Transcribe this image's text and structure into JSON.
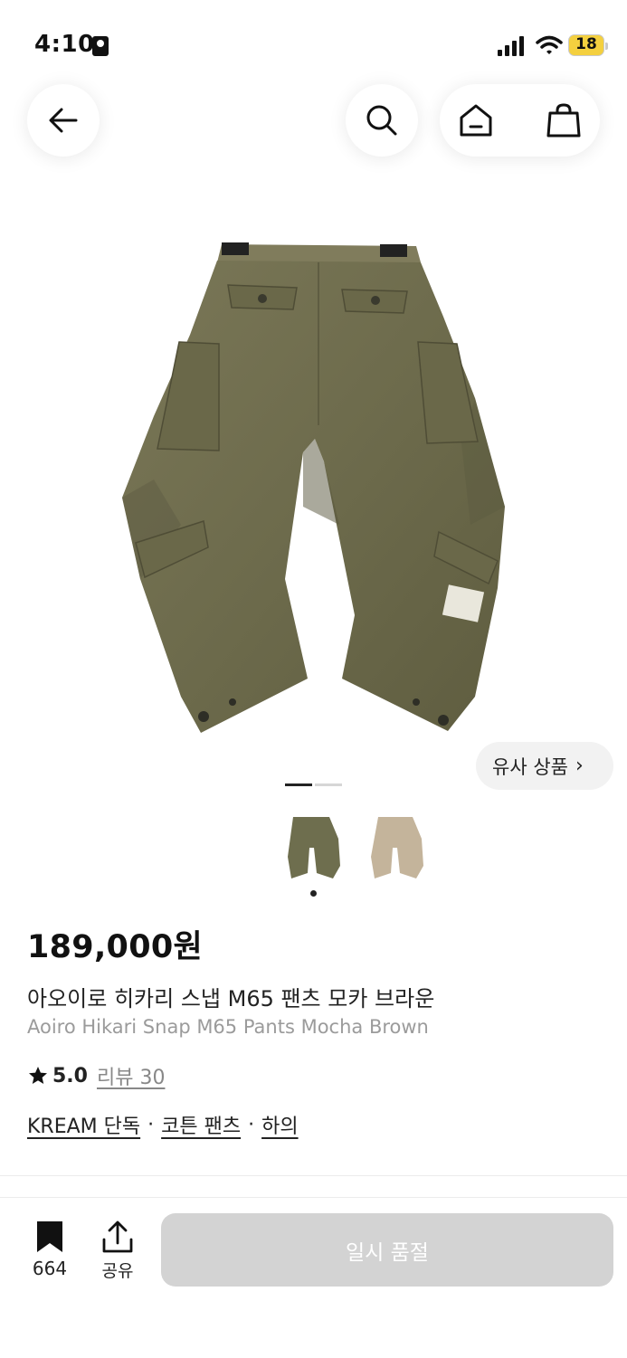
{
  "status": {
    "time": "4:10",
    "battery": "18"
  },
  "nav": {
    "back_icon": "arrow-left-icon",
    "search_icon": "search-icon",
    "home_icon": "home-icon",
    "cart_icon": "shopping-bag-icon"
  },
  "gallery": {
    "similar_label": "유사 상품",
    "chevron": "›",
    "thumbnail_colors": [
      "#6e6e4e",
      "#c4b49b"
    ]
  },
  "product": {
    "price": "189,000원",
    "name_ko": "아오이로 히카리 스냅 M65 팬츠 모카 브라운",
    "name_en": "Aoiro Hikari Snap M65 Pants Mocha Brown",
    "rating": "5.0",
    "review_label": "리뷰 30",
    "tags": [
      "KREAM 단독",
      "코튼 팬츠",
      "하의"
    ],
    "tag_separator": "·"
  },
  "bottom_bar": {
    "bookmark_count": "664",
    "share_label": "공유",
    "cta_label": "일시 품절"
  }
}
